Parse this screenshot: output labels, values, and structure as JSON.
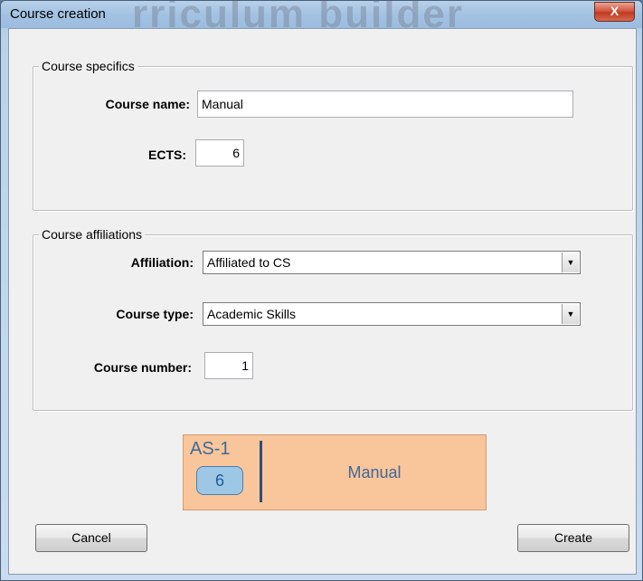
{
  "window": {
    "title": "Course creation",
    "background_title": "rriculum builder",
    "close_glyph": "X"
  },
  "course_specifics": {
    "legend": "Course specifics",
    "course_name_label": "Course name:",
    "course_name_value": "Manual",
    "ects_label": "ECTS:",
    "ects_value": "6"
  },
  "course_affiliations": {
    "legend": "Course affiliations",
    "affiliation_label": "Affiliation:",
    "affiliation_value": "Affiliated to CS",
    "course_type_label": "Course type:",
    "course_type_value": "Academic Skills",
    "course_number_label": "Course number:",
    "course_number_value": "1"
  },
  "preview": {
    "code": "AS-1",
    "ects": "6",
    "name": "Manual",
    "colors": {
      "card": "#f9c59a",
      "badge": "#9ec7e5",
      "text": "#3f6a99",
      "divider": "#2e4f7c"
    }
  },
  "buttons": {
    "cancel": "Cancel",
    "create": "Create"
  },
  "icons": {
    "dropdown": "chevron-down-icon",
    "close": "close-icon"
  }
}
